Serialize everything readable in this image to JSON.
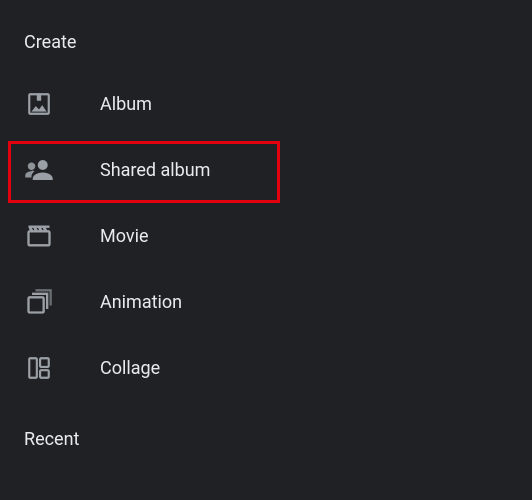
{
  "sections": {
    "create": {
      "label": "Create"
    },
    "recent": {
      "label": "Recent"
    }
  },
  "menu": {
    "items": [
      {
        "label": "Album"
      },
      {
        "label": "Shared album"
      },
      {
        "label": "Movie"
      },
      {
        "label": "Animation"
      },
      {
        "label": "Collage"
      }
    ]
  }
}
